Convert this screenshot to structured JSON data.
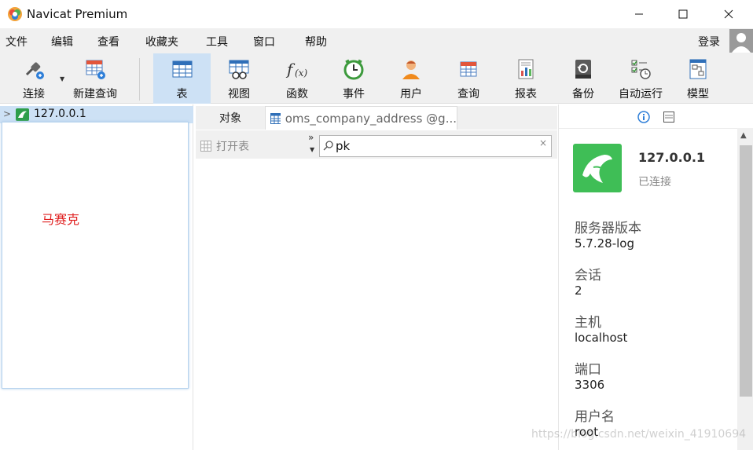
{
  "window": {
    "title": "Navicat Premium"
  },
  "menu": {
    "items": [
      "文件",
      "编辑",
      "查看",
      "收藏夹",
      "工具",
      "窗口",
      "帮助"
    ],
    "login": "登录"
  },
  "toolbar": {
    "buttons": [
      {
        "label": "连接",
        "icon": "plug-icon"
      },
      {
        "label": "新建查询",
        "icon": "new-query-icon"
      },
      {
        "label": "表",
        "icon": "table-icon",
        "active": true
      },
      {
        "label": "视图",
        "icon": "view-icon"
      },
      {
        "label": "函数",
        "icon": "function-icon"
      },
      {
        "label": "事件",
        "icon": "clock-icon"
      },
      {
        "label": "用户",
        "icon": "user-icon"
      },
      {
        "label": "查询",
        "icon": "query-icon"
      },
      {
        "label": "报表",
        "icon": "report-icon"
      },
      {
        "label": "备份",
        "icon": "backup-icon"
      },
      {
        "label": "自动运行",
        "icon": "automation-icon"
      },
      {
        "label": "模型",
        "icon": "model-icon"
      }
    ]
  },
  "navigator": {
    "connection": "127.0.0.1",
    "mosaic_label": "马赛克"
  },
  "tabs": {
    "objects": "对象",
    "table_tab": "oms_company_address @g..."
  },
  "object_bar": {
    "open_table": "打开表",
    "search_value": "pk"
  },
  "info_panel": {
    "host": "127.0.0.1",
    "status": "已连接",
    "properties": [
      {
        "label": "服务器版本",
        "value": "5.7.28-log"
      },
      {
        "label": "会话",
        "value": "2"
      },
      {
        "label": "主机",
        "value": "localhost"
      },
      {
        "label": "端口",
        "value": "3306"
      },
      {
        "label": "用户名",
        "value": "root"
      }
    ]
  },
  "watermark": "https://blog.csdn.net/weixin_41910694",
  "colors": {
    "accent": "#cde1f5",
    "mysql_green": "#3fbe56",
    "mosaic_text": "#e02020"
  }
}
